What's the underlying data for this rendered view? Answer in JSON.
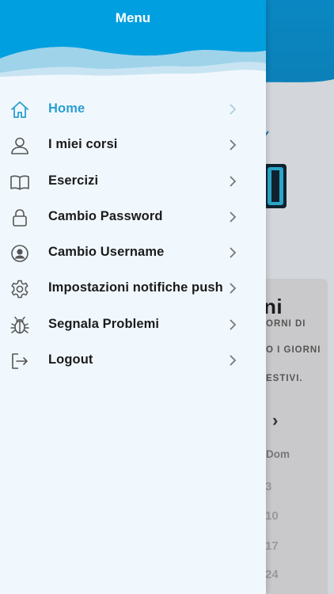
{
  "drawer": {
    "title": "Menu",
    "active_color": "#2a9fd2",
    "items": [
      {
        "label": "Home",
        "icon": "home-icon",
        "active": true
      },
      {
        "label": "I miei corsi",
        "icon": "user-icon",
        "active": false
      },
      {
        "label": "Esercizi",
        "icon": "book-icon",
        "active": false
      },
      {
        "label": "Cambio Password",
        "icon": "lock-icon",
        "active": false
      },
      {
        "label": "Cambio Username",
        "icon": "user-circle-icon",
        "active": false
      },
      {
        "label": "Impostazioni notifiche push",
        "icon": "gear-icon",
        "active": false
      },
      {
        "label": "Segnala Problemi",
        "icon": "bug-icon",
        "active": false
      },
      {
        "label": "Logout",
        "icon": "logout-icon",
        "active": false
      }
    ]
  },
  "background": {
    "card_title": "ni",
    "line1": "ORNI DI",
    "line2": "O I GIORNI",
    "line3": "ESTIVI.",
    "day_label": "Dom",
    "dates": [
      "3",
      "10",
      "17",
      "24"
    ]
  }
}
